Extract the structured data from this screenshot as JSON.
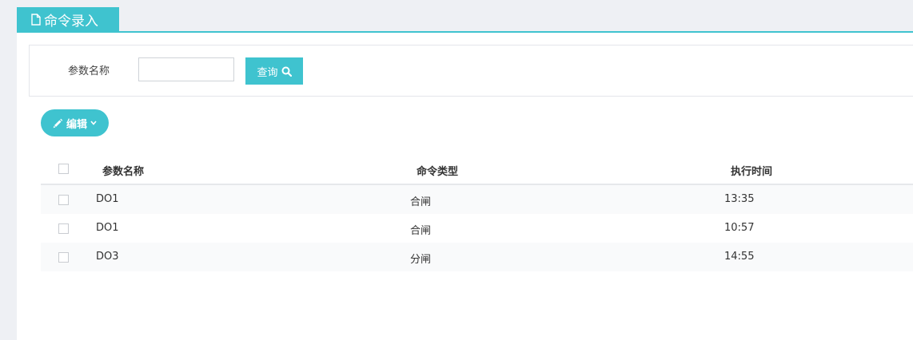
{
  "panel": {
    "tab_title": "命令录入",
    "tab_icon": "document-icon"
  },
  "search": {
    "label": "参数名称",
    "input_value": "",
    "input_placeholder": "",
    "button_label": "查询",
    "button_icon": "search-icon"
  },
  "toolbar": {
    "edit_label": "编辑",
    "edit_icon": "pencil-icon",
    "dropdown_icon": "chevron-down-icon"
  },
  "table": {
    "headers": [
      "参数名称",
      "命令类型",
      "执行时间"
    ],
    "rows": [
      [
        "DO1",
        "合闸",
        "13:35"
      ],
      [
        "DO1",
        "合闸",
        "10:57"
      ],
      [
        "DO3",
        "分闸",
        "14:55"
      ]
    ]
  },
  "colors": {
    "accent": "#3fc3cf",
    "page_bg": "#eef0f4",
    "row_stripe": "#f9fafb",
    "border": "#e4e6ea"
  }
}
